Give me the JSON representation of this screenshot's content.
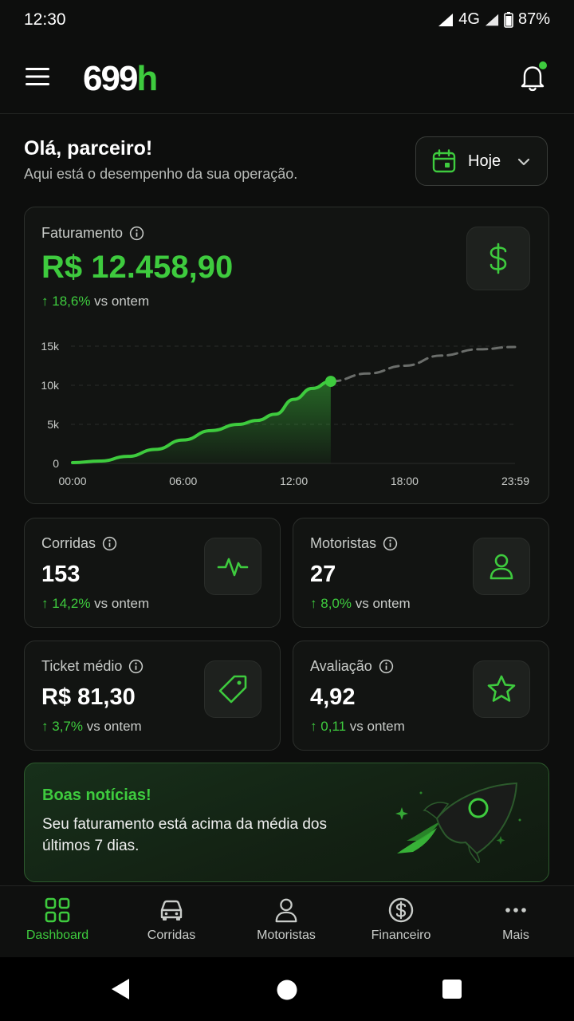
{
  "status_bar": {
    "time": "12:30",
    "network": "4G",
    "battery": "87%"
  },
  "header": {
    "logo_main": "699",
    "logo_accent": "h"
  },
  "greeting": {
    "title": "Olá, parceiro!",
    "subtitle": "Aqui está o desempenho da sua operação.",
    "date_filter": "Hoje"
  },
  "revenue": {
    "label": "Faturamento",
    "value": "R$ 12.458,90",
    "trend_value": "18,6%",
    "trend_suffix": "vs ontem"
  },
  "chart_data": {
    "type": "line",
    "y_ticks": [
      "15k",
      "10k",
      "5k",
      "0"
    ],
    "x_ticks": [
      "00:00",
      "06:00",
      "12:00",
      "18:00",
      "23:59"
    ],
    "ylim": [
      0,
      15000
    ],
    "series": [
      {
        "x": [
          0,
          1.5,
          3,
          4.5,
          6,
          7.5,
          9,
          10,
          11,
          12,
          13,
          14
        ],
        "y": [
          100,
          300,
          900,
          1800,
          3000,
          4200,
          5000,
          5500,
          6300,
          8200,
          9600,
          10500
        ]
      },
      {
        "x": [
          14,
          16,
          18,
          20,
          22,
          23.99
        ],
        "y": [
          10500,
          11500,
          12500,
          13800,
          14600,
          14900
        ]
      }
    ],
    "colors": {
      "actual": "#3ecb3e",
      "projection": "#6b6e6b"
    }
  },
  "stats": [
    {
      "label": "Corridas",
      "value": "153",
      "trend_value": "14,2%",
      "trend_suffix": "vs ontem",
      "icon": "activity-icon"
    },
    {
      "label": "Motoristas",
      "value": "27",
      "trend_value": "8,0%",
      "trend_suffix": "vs ontem",
      "icon": "user-icon"
    },
    {
      "label": "Ticket médio",
      "value": "R$ 81,30",
      "trend_value": "3,7%",
      "trend_suffix": "vs ontem",
      "icon": "tag-icon"
    },
    {
      "label": "Avaliação",
      "value": "4,92",
      "trend_value": "0,11",
      "trend_suffix": "vs ontem",
      "icon": "star-icon"
    }
  ],
  "banner": {
    "title": "Boas notícias!",
    "text": "Seu faturamento está acima da média dos últimos 7 dias."
  },
  "nav": {
    "items": [
      {
        "label": "Dashboard",
        "icon": "grid-icon",
        "active": true
      },
      {
        "label": "Corridas",
        "icon": "car-icon",
        "active": false
      },
      {
        "label": "Motoristas",
        "icon": "user-icon",
        "active": false
      },
      {
        "label": "Financeiro",
        "icon": "dollar-circle-icon",
        "active": false
      },
      {
        "label": "Mais",
        "icon": "more-icon",
        "active": false
      }
    ]
  },
  "colors": {
    "accent": "#3ecb3e",
    "background": "#0d0e0d",
    "card": "#121412"
  }
}
